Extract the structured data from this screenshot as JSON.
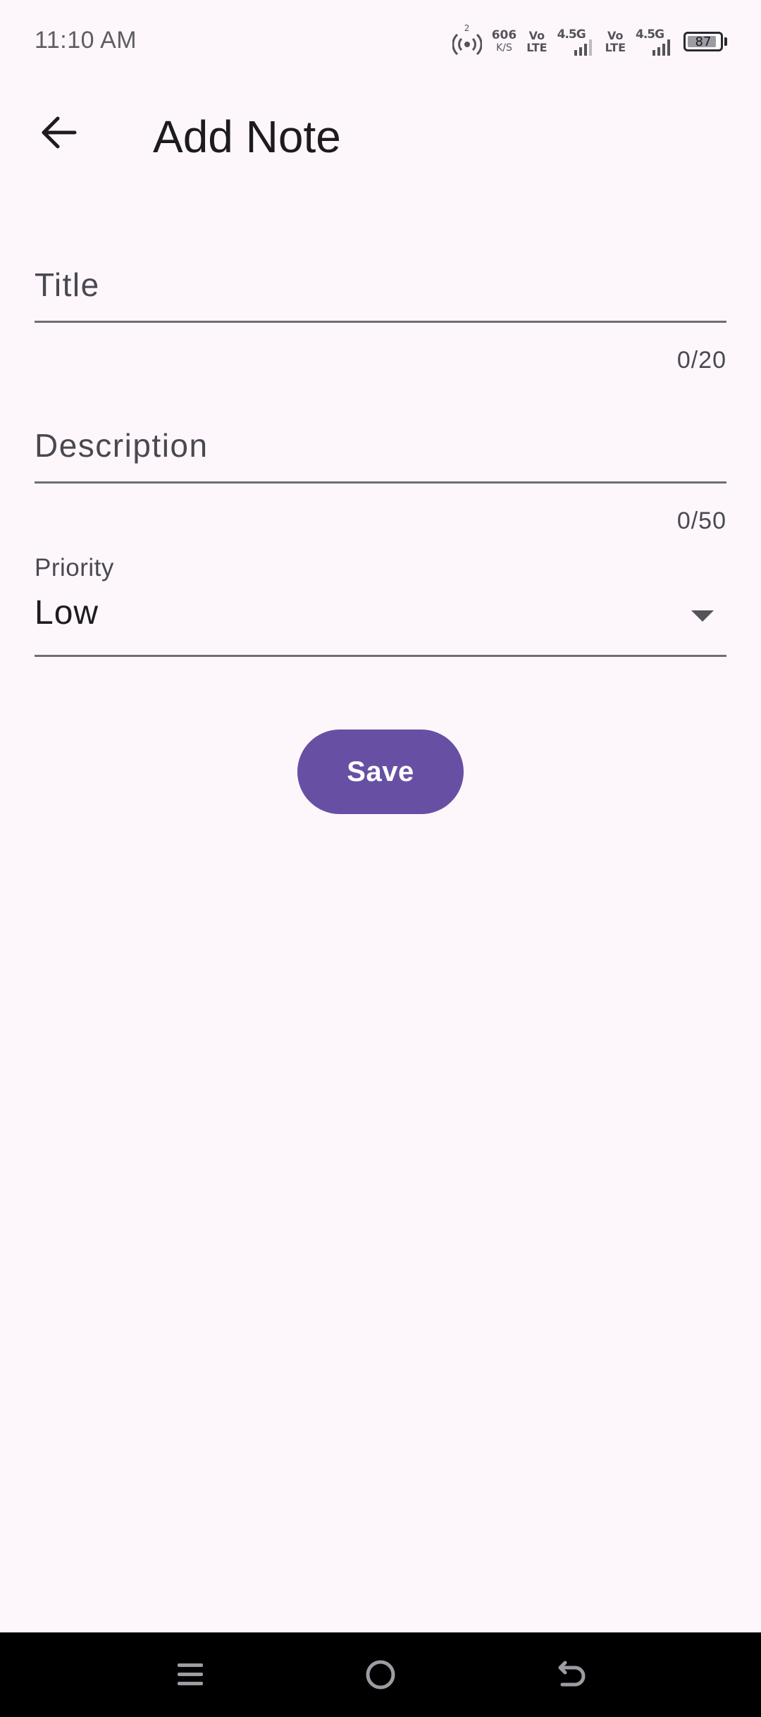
{
  "status_bar": {
    "time": "11:10 AM",
    "hotspot_count": "2",
    "net_speed_value": "606",
    "net_speed_unit": "K/S",
    "sim1_volte_top": "Vo",
    "sim1_volte_bottom": "LTE",
    "sim1_network": "4.5G",
    "sim2_volte_top": "Vo",
    "sim2_volte_bottom": "LTE",
    "sim2_network": "4.5G",
    "battery_level": "87",
    "icons": [
      "hotspot-icon",
      "signal-icon",
      "signal-icon",
      "battery-icon"
    ]
  },
  "app_bar": {
    "back_icon": "arrow-left-icon",
    "title": "Add Note"
  },
  "form": {
    "title_field": {
      "placeholder": "Title",
      "value": "",
      "counter": "0/20"
    },
    "description_field": {
      "placeholder": "Description",
      "value": "",
      "counter": "0/50"
    },
    "priority": {
      "label": "Priority",
      "selected": "Low",
      "icon": "dropdown-arrow-icon"
    },
    "save_label": "Save"
  },
  "nav_bar": {
    "icons": [
      "menu-icon",
      "home-icon",
      "back-icon"
    ]
  },
  "colors": {
    "background": "#fdf7fc",
    "accent": "#6750a4",
    "nav_bar": "#000000",
    "underline": "#6f6d72"
  }
}
